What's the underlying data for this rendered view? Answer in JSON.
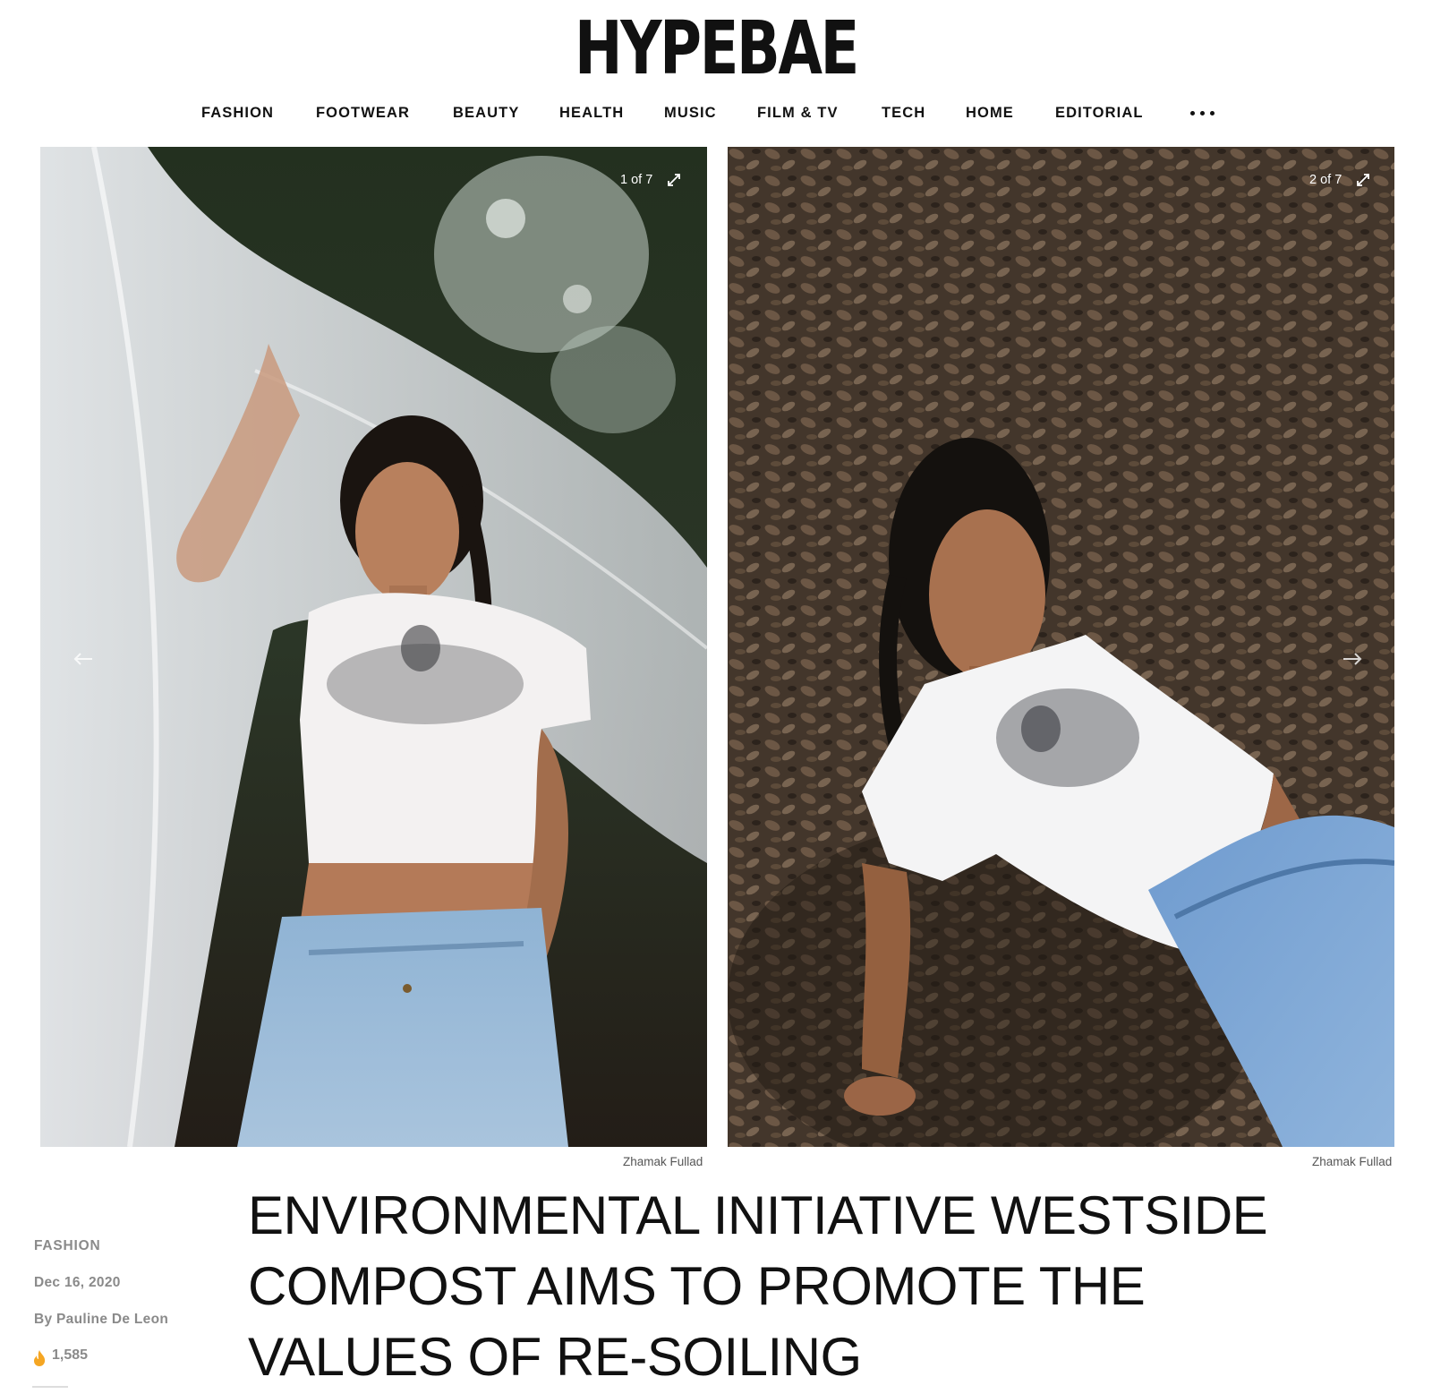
{
  "header": {
    "logo": "HYPEBAE"
  },
  "nav": {
    "items": [
      {
        "label": "FASHION"
      },
      {
        "label": "FOOTWEAR"
      },
      {
        "label": "BEAUTY"
      },
      {
        "label": "HEALTH"
      },
      {
        "label": "MUSIC"
      },
      {
        "label": "FILM & TV"
      },
      {
        "label": "TECH"
      },
      {
        "label": "HOME"
      },
      {
        "label": "EDITORIAL"
      }
    ],
    "more_icon": "more-dots-icon"
  },
  "gallery": {
    "images": [
      {
        "counter": "1 of 7",
        "credit": "Zhamak Fullad",
        "alt": "Model in white cropped t-shirt and jeans holding sheer white fabric among trees"
      },
      {
        "counter": "2 of 7",
        "credit": "Zhamak Fullad",
        "alt": "Model in white cropped t-shirt and jeans leaning on ground covered with dry leaves"
      }
    ],
    "prev_icon": "arrow-left-icon",
    "next_icon": "arrow-right-icon",
    "expand_icon": "expand-icon"
  },
  "article": {
    "category": "FASHION",
    "date": "Dec 16, 2020",
    "author": "By Pauline De Leon",
    "views": "1,585",
    "views_icon": "flame-icon",
    "headline": "ENVIRONMENTAL INITIATIVE WESTSIDE COMPOST AIMS TO PROMOTE THE VALUES OF RE-SOILING"
  },
  "colors": {
    "text": "#111111",
    "meta": "#8a8a8a",
    "flame": "#f5a623"
  }
}
